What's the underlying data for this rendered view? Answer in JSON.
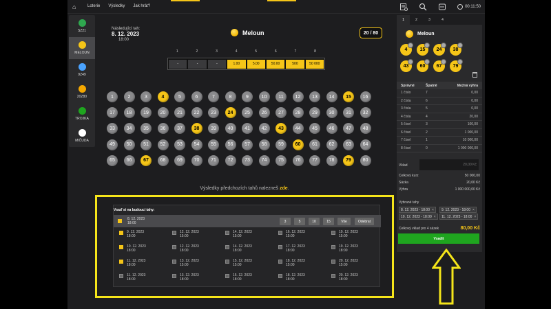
{
  "nav": {
    "items": [
      "Loterie",
      "Výsledky",
      "Jak hrát?"
    ]
  },
  "clock": "00:11:50",
  "sidebar": [
    {
      "label": "SZ21",
      "color": "#2fa84f",
      "active": false
    },
    {
      "label": "MELOUN",
      "color": "#f5c518",
      "active": true
    },
    {
      "label": "9Z49",
      "color": "#4aa3ff",
      "active": false
    },
    {
      "label": "20Z80",
      "color": "#f5a800",
      "active": false
    },
    {
      "label": "TROJKA",
      "color": "#1fa51f",
      "active": false
    },
    {
      "label": "MIČUDA",
      "color": "#ffffff",
      "active": false
    }
  ],
  "draw": {
    "next_label": "Následující tah:",
    "date": "8. 12. 2023",
    "time": "18:00"
  },
  "game": {
    "title": "Meloun",
    "counter": "20 / 80"
  },
  "prizes": {
    "positions": [
      "1",
      "2",
      "3",
      "4",
      "5",
      "6",
      "7",
      "8"
    ],
    "values": [
      "-",
      "-",
      "-",
      "1.00",
      "5.00",
      "50.00",
      "500",
      "50 000"
    ]
  },
  "numbers": {
    "selected": [
      4,
      15,
      24,
      38,
      43,
      60,
      67,
      79
    ]
  },
  "previous": {
    "text": "Výsledky předchozích tahů nalezneš",
    "link": "zde",
    "end": "."
  },
  "future": {
    "title": "Vsaď si na budoucí tahy:",
    "head_date": "8. 12. 2023",
    "head_time": "18:00",
    "quick_buttons": [
      "3",
      "5",
      "10",
      "15",
      "Vše",
      "Odebrat"
    ],
    "cells": [
      [
        {
          "d": "9. 12. 2023",
          "t": "18:00",
          "on": true
        },
        {
          "d": "12. 12. 2023",
          "t": "15:00",
          "on": false
        },
        {
          "d": "14. 12. 2023",
          "t": "15:00",
          "on": false
        },
        {
          "d": "16. 12. 2023",
          "t": "15:00",
          "on": false
        },
        {
          "d": "19. 12. 2023",
          "t": "15:00",
          "on": false
        }
      ],
      [
        {
          "d": "10. 12. 2023",
          "t": "18:00",
          "on": true
        },
        {
          "d": "12. 12. 2023",
          "t": "18:00",
          "on": false
        },
        {
          "d": "14. 12. 2023",
          "t": "18:00",
          "on": false
        },
        {
          "d": "17. 12. 2023",
          "t": "18:00",
          "on": false
        },
        {
          "d": "19. 12. 2023",
          "t": "18:00",
          "on": false
        }
      ],
      [
        {
          "d": "11. 12. 2023",
          "t": "18:00",
          "on": true
        },
        {
          "d": "13. 12. 2023",
          "t": "15:00",
          "on": false
        },
        {
          "d": "15. 12. 2023",
          "t": "15:00",
          "on": false
        },
        {
          "d": "18. 12. 2023",
          "t": "15:00",
          "on": false
        },
        {
          "d": "20. 12. 2023",
          "t": "15:00",
          "on": false
        }
      ],
      [
        {
          "d": "11. 12. 2023",
          "t": "18:00",
          "on": false
        },
        {
          "d": "13. 12. 2023",
          "t": "18:00",
          "on": false
        },
        {
          "d": "15. 12. 2023",
          "t": "18:00",
          "on": false
        },
        {
          "d": "18. 12. 2023",
          "t": "18:00",
          "on": false
        },
        {
          "d": "20. 12. 2023",
          "t": "18:00",
          "on": false
        }
      ]
    ]
  },
  "ticket": {
    "tabs": [
      "1",
      "2",
      "3",
      "4"
    ],
    "game": "Meloun",
    "picks": [
      4,
      15,
      24,
      38,
      43,
      60,
      67,
      79
    ],
    "odds_headers": [
      "Správně",
      "Špatně",
      "Možná výhra"
    ],
    "odds": [
      [
        "1 číslo",
        "7",
        "0,00"
      ],
      [
        "2 čísla",
        "6",
        "0,00"
      ],
      [
        "3 čísla",
        "5",
        "0,00"
      ],
      [
        "4 čísla",
        "4",
        "20,00"
      ],
      [
        "5 čísel",
        "3",
        "100,00"
      ],
      [
        "6 čísel",
        "2",
        "1 000,00"
      ],
      [
        "7 čísel",
        "1",
        "10 000,00"
      ],
      [
        "8 čísel",
        "0",
        "1 000 000,00"
      ]
    ],
    "stake_label": "Vklad",
    "stake_placeholder": "20,00 Kč",
    "summary": [
      [
        "Celkový kurz",
        "50 000,00"
      ],
      [
        "Sázka",
        "20,00 Kč"
      ],
      [
        "Výhra",
        "1 000 000,00 Kč"
      ]
    ],
    "selected_label": "Vybrané tahy",
    "chips": [
      "8. 12. 2023 - 18:00",
      "9. 12. 2023 - 18:00",
      "10. 12. 2023 - 18:00",
      "11. 12. 2023 - 18:00"
    ],
    "total_label": "Celkový vklad pro 4 sázek",
    "total_value": "80,00 Kč",
    "bet_label": "Vsadit"
  },
  "colors": {
    "accent": "#f5c518",
    "bet": "#1fa51f",
    "frame": "#f5e51a"
  }
}
